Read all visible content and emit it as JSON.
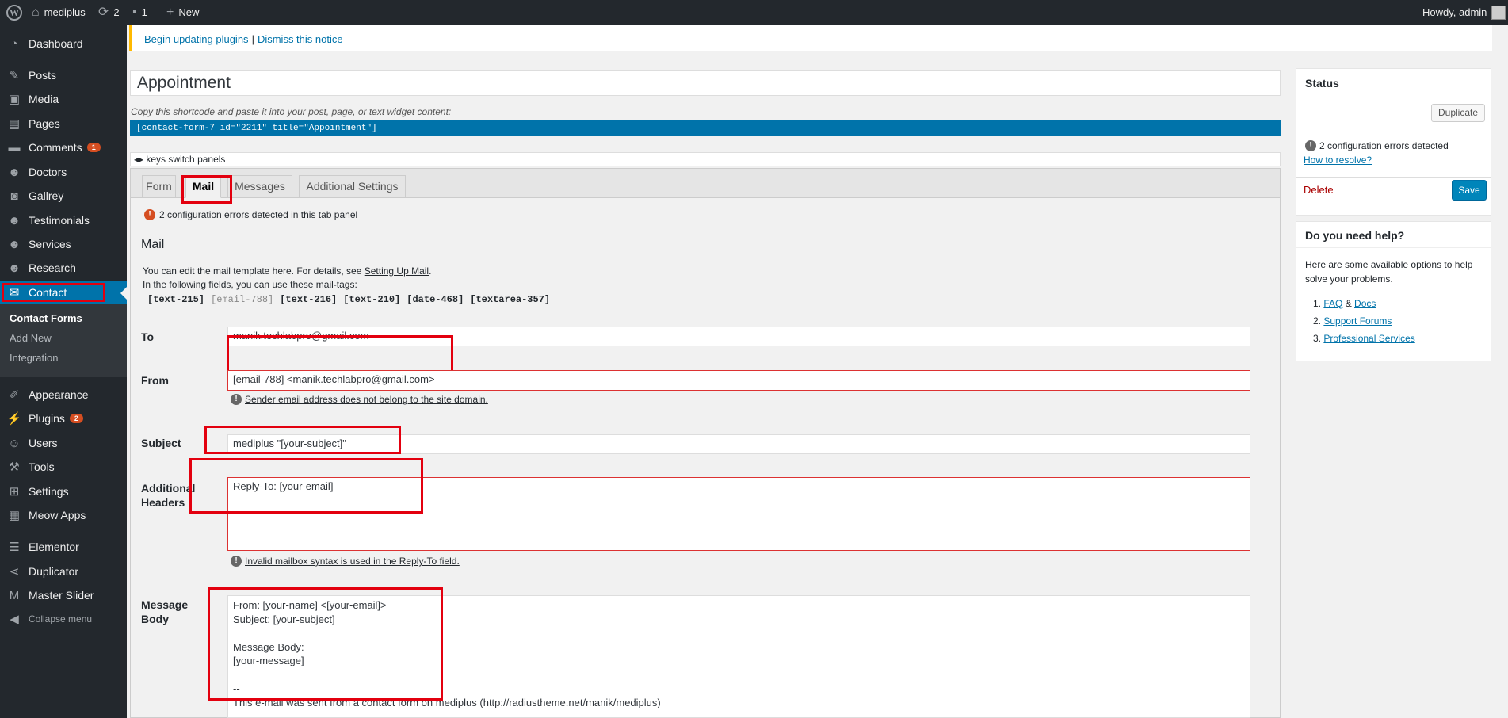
{
  "adminbar": {
    "site_name": "mediplus",
    "updates_count": "2",
    "comments_count": "1",
    "new_label": "New",
    "howdy": "Howdy, admin"
  },
  "sidebar": {
    "items": [
      {
        "label": "Dashboard",
        "icon": "dashboard-icon"
      },
      {
        "label": "Posts",
        "icon": "pin-icon"
      },
      {
        "label": "Media",
        "icon": "media-icon"
      },
      {
        "label": "Pages",
        "icon": "pages-icon"
      },
      {
        "label": "Comments",
        "icon": "comment-icon",
        "badge": "1"
      },
      {
        "label": "Doctors",
        "icon": "person-icon"
      },
      {
        "label": "Gallrey",
        "icon": "camera-icon"
      },
      {
        "label": "Testimonials",
        "icon": "person-icon"
      },
      {
        "label": "Services",
        "icon": "person-icon"
      },
      {
        "label": "Research",
        "icon": "person-icon"
      },
      {
        "label": "Contact",
        "icon": "mail-icon"
      },
      {
        "label": "Appearance",
        "icon": "brush-icon"
      },
      {
        "label": "Plugins",
        "icon": "plug-icon",
        "badge": "2"
      },
      {
        "label": "Users",
        "icon": "users-icon"
      },
      {
        "label": "Tools",
        "icon": "wrench-icon"
      },
      {
        "label": "Settings",
        "icon": "settings-icon"
      },
      {
        "label": "Meow Apps",
        "icon": "grid-icon"
      },
      {
        "label": "Elementor",
        "icon": "elementor-icon"
      },
      {
        "label": "Duplicator",
        "icon": "share-icon"
      },
      {
        "label": "Master Slider",
        "icon": "slider-icon"
      },
      {
        "label": "Collapse menu",
        "icon": "collapse-icon"
      }
    ],
    "submenu": [
      "Contact Forms",
      "Add New",
      "Integration"
    ]
  },
  "notice": {
    "begin_updating": "Begin updating plugins",
    "separator": "|",
    "dismiss": "Dismiss this notice"
  },
  "form": {
    "title": "Appointment",
    "shortcode_label": "Copy this shortcode and paste it into your post, page, or text widget content:",
    "shortcode": "[contact-form-7 id=\"2211\" title=\"Appointment\"]",
    "keys_hint": "◂▸ keys switch panels"
  },
  "tabs": [
    "Form",
    "Mail",
    "Messages",
    "Additional Settings"
  ],
  "mail": {
    "panel_errors": "2 configuration errors detected in this tab panel",
    "heading": "Mail",
    "intro_prefix": "You can edit the mail template here. For details, see ",
    "intro_link": "Setting Up Mail",
    "intro_suffix": ".",
    "tags_intro": "In the following fields, you can use these mail-tags:",
    "tags": [
      "[text-215]",
      "[email-788]",
      "[text-216]",
      "[text-210]",
      "[date-468]",
      "[textarea-357]"
    ],
    "to_label": "To",
    "to_value": "manik.techlabpro@gmail.com",
    "from_label": "From",
    "from_value": "[email-788] <manik.techlabpro@gmail.com>",
    "from_error": "Sender email address does not belong to the site domain.",
    "subject_label": "Subject",
    "subject_value": "mediplus \"[your-subject]\"",
    "headers_label_1": "Additional",
    "headers_label_2": "Headers",
    "headers_value": "Reply-To: [your-email]",
    "headers_error": "Invalid mailbox syntax is used in the Reply-To field.",
    "body_label_1": "Message",
    "body_label_2": "Body",
    "body_lines": [
      "From: [your-name] <[your-email]>",
      "Subject: [your-subject]",
      "",
      "Message Body:",
      "[your-message]",
      "",
      "--",
      "This e-mail was sent from a contact form on mediplus (http://radiustheme.net/manik/mediplus)"
    ]
  },
  "status_box": {
    "title": "Status",
    "duplicate": "Duplicate",
    "errors": "2 configuration errors detected",
    "how_to": "How to resolve?",
    "delete": "Delete",
    "save": "Save"
  },
  "help_box": {
    "title": "Do you need help?",
    "text": "Here are some available options to help solve your problems.",
    "items": [
      {
        "num": "1.",
        "a": "FAQ",
        "and": " & ",
        "b": "Docs"
      },
      {
        "num": "2.",
        "a": "Support Forums"
      },
      {
        "num": "3.",
        "a": "Professional Services"
      }
    ]
  }
}
